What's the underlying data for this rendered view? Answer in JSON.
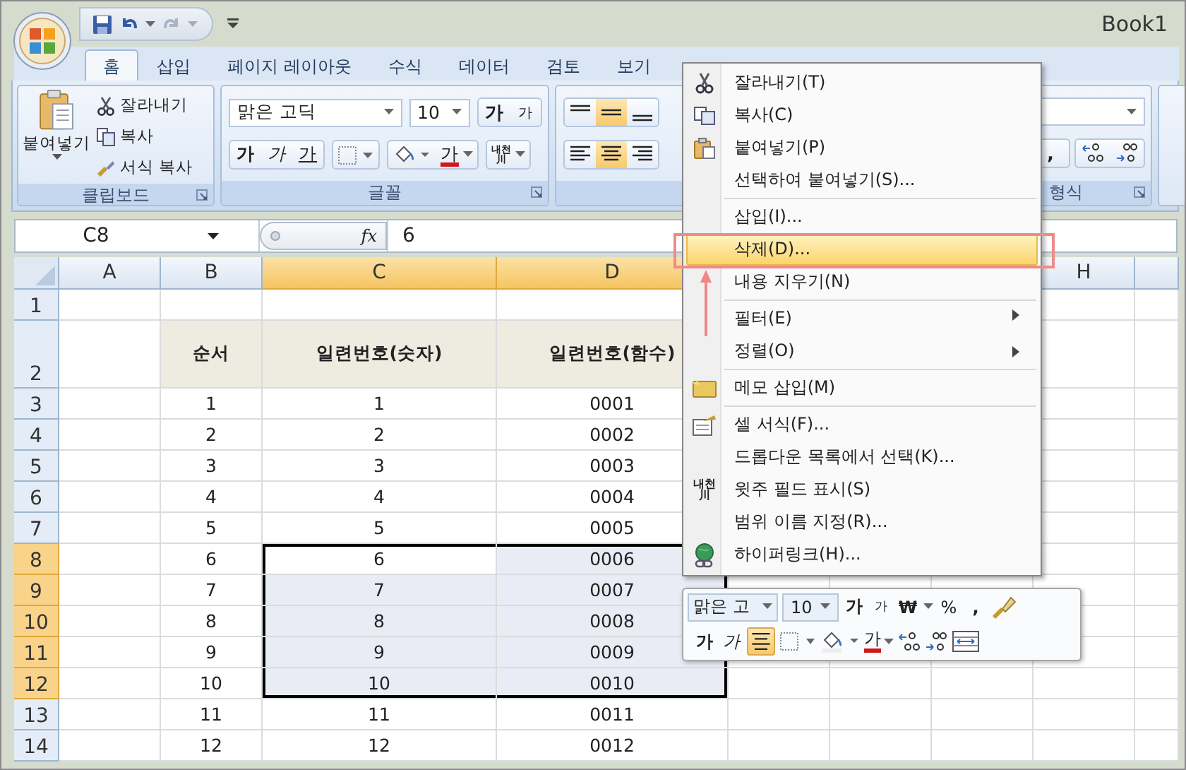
{
  "window": {
    "title": "Book1"
  },
  "tabs": [
    {
      "label": "홈",
      "selected": true
    },
    {
      "label": "삽입",
      "selected": false
    },
    {
      "label": "페이지 레이아웃",
      "selected": false
    },
    {
      "label": "수식",
      "selected": false
    },
    {
      "label": "데이터",
      "selected": false
    },
    {
      "label": "검토",
      "selected": false
    },
    {
      "label": "보기",
      "selected": false
    }
  ],
  "clipboard": {
    "label": "클립보드",
    "paste": "붙여넣기",
    "actions": [
      "잘라내기",
      "복사",
      "서식 복사"
    ]
  },
  "font": {
    "label": "글꼴",
    "family": "맑은 고딕",
    "size": "10",
    "grow": "가",
    "shrink": "가",
    "bold": "가",
    "italic": "가",
    "underline": "가",
    "font_color_label": "가",
    "phonetic": [
      "내천",
      "川"
    ]
  },
  "alignment": {
    "vertical": [
      {
        "selected": false
      },
      {
        "selected": true
      },
      {
        "selected": false
      }
    ],
    "horizontal": [
      {
        "selected": false
      },
      {
        "selected": true
      },
      {
        "selected": false
      }
    ]
  },
  "number": {
    "label": "형식",
    "comma": ","
  },
  "formula_bar": {
    "name_box": "C8",
    "function_label": "fx",
    "value": "6"
  },
  "columns": [
    {
      "kind": "lettered",
      "label": "A",
      "selected": false
    },
    {
      "kind": "lettered",
      "label": "B",
      "selected": false
    },
    {
      "kind": "lettered",
      "label": "C",
      "selected": true
    },
    {
      "kind": "lettered",
      "label": "D",
      "selected": true
    },
    {
      "kind": "hidden"
    },
    {
      "kind": "hidden"
    },
    {
      "kind": "hidden"
    },
    {
      "kind": "lettered",
      "label": "H",
      "selected": false
    },
    {
      "kind": "blank",
      "selected": false
    }
  ],
  "rows": [
    {
      "number": "1",
      "selected": false,
      "kind": "data"
    },
    {
      "number": "2",
      "selected": false,
      "kind": "heading",
      "b": "순서",
      "c": "일련번호(숫자)",
      "d": "일련번호(함수)"
    },
    {
      "number": "3",
      "selected": false,
      "kind": "data",
      "b": "1",
      "c": "1",
      "d": "0001"
    },
    {
      "number": "4",
      "selected": false,
      "kind": "data",
      "b": "2",
      "c": "2",
      "d": "0002"
    },
    {
      "number": "5",
      "selected": false,
      "kind": "data",
      "b": "3",
      "c": "3",
      "d": "0003"
    },
    {
      "number": "6",
      "selected": false,
      "kind": "data",
      "b": "4",
      "c": "4",
      "d": "0004"
    },
    {
      "number": "7",
      "selected": false,
      "kind": "data",
      "b": "5",
      "c": "5",
      "d": "0005"
    },
    {
      "number": "8",
      "selected": true,
      "kind": "data",
      "b": "6",
      "c": "6",
      "d": "0006"
    },
    {
      "number": "9",
      "selected": true,
      "kind": "data",
      "b": "7",
      "c": "7",
      "d": "0007"
    },
    {
      "number": "10",
      "selected": true,
      "kind": "data",
      "b": "8",
      "c": "8",
      "d": "0008"
    },
    {
      "number": "11",
      "selected": true,
      "kind": "data",
      "b": "9",
      "c": "9",
      "d": "0009"
    },
    {
      "number": "12",
      "selected": true,
      "kind": "data",
      "b": "10",
      "c": "10",
      "d": "0010"
    },
    {
      "number": "13",
      "selected": false,
      "kind": "data",
      "b": "11",
      "c": "11",
      "d": "0011"
    },
    {
      "number": "14",
      "selected": false,
      "kind": "data",
      "b": "12",
      "c": "12",
      "d": "0012"
    }
  ],
  "context_menu": [
    {
      "label": "잘라내기(T)",
      "selected": false,
      "separator_before": false,
      "submenu": false
    },
    {
      "label": "복사(C)",
      "selected": false,
      "separator_before": false,
      "submenu": false
    },
    {
      "label": "붙여넣기(P)",
      "selected": false,
      "separator_before": false,
      "submenu": false
    },
    {
      "label": "선택하여 붙여넣기(S)...",
      "selected": false,
      "separator_before": false,
      "submenu": false
    },
    {
      "label": "삽입(I)...",
      "selected": false,
      "separator_before": true,
      "submenu": false
    },
    {
      "label": "삭제(D)...",
      "selected": true,
      "separator_before": false,
      "submenu": false
    },
    {
      "label": "내용 지우기(N)",
      "selected": false,
      "separator_before": false,
      "submenu": false
    },
    {
      "label": "필터(E)",
      "selected": false,
      "separator_before": true,
      "submenu": true
    },
    {
      "label": "정렬(O)",
      "selected": false,
      "separator_before": false,
      "submenu": true
    },
    {
      "label": "메모 삽입(M)",
      "selected": false,
      "separator_before": true,
      "submenu": false
    },
    {
      "label": "셀 서식(F)...",
      "selected": false,
      "separator_before": true,
      "submenu": false
    },
    {
      "label": "드롭다운 목록에서 선택(K)...",
      "selected": false,
      "separator_before": false,
      "submenu": false
    },
    {
      "label": "윗주 필드 표시(S)",
      "selected": false,
      "separator_before": false,
      "submenu": false,
      "icon_text": [
        "내천",
        "川"
      ]
    },
    {
      "label": "범위 이름 지정(R)...",
      "selected": false,
      "separator_before": false,
      "submenu": false
    },
    {
      "label": "하이퍼링크(H)...",
      "selected": false,
      "separator_before": false,
      "submenu": false
    }
  ],
  "mini_toolbar": {
    "font": "맑은 고",
    "size": "10",
    "grow": "가",
    "shrink": "가",
    "currency": "₩",
    "percent": "%",
    "comma": ",",
    "bold": "가",
    "italic": "가",
    "align_center": {
      "selected": true
    },
    "font_color_label": "가"
  }
}
